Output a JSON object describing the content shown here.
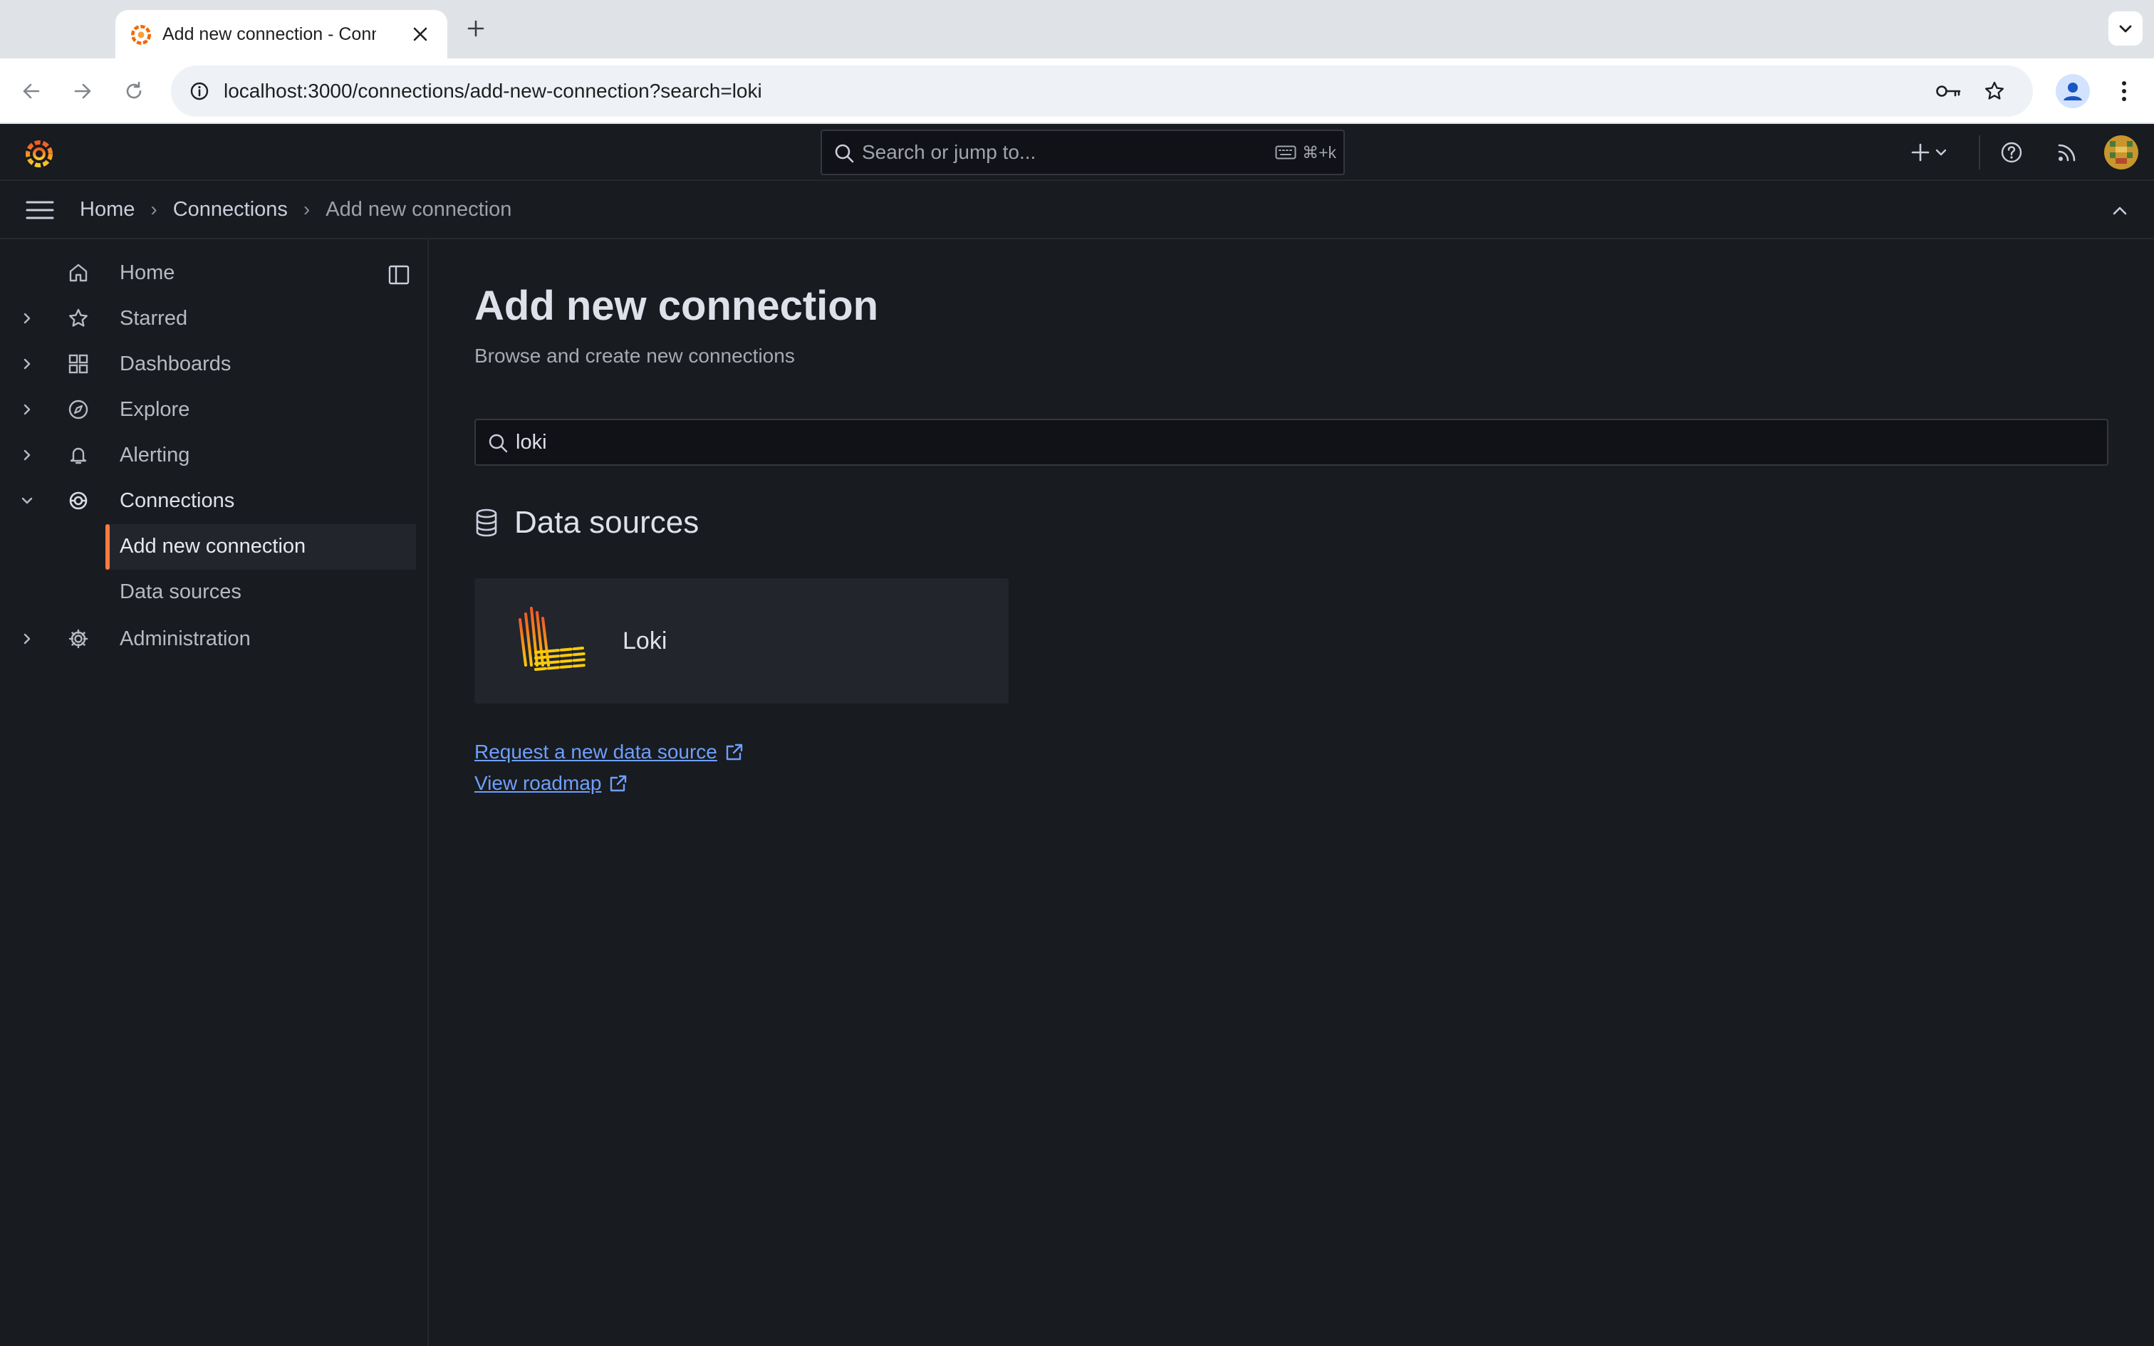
{
  "browser": {
    "tab_title": "Add new connection - Connections - Grafana",
    "url": "localhost:3000/connections/add-new-connection?search=loki"
  },
  "topbar": {
    "search_placeholder": "Search or jump to...",
    "search_shortcut": "⌘+k"
  },
  "breadcrumb": {
    "items": [
      "Home",
      "Connections"
    ],
    "current": "Add new connection",
    "separator": "›"
  },
  "sidebar": {
    "items": [
      {
        "label": "Home",
        "icon": "home-icon"
      },
      {
        "label": "Starred",
        "icon": "star-icon"
      },
      {
        "label": "Dashboards",
        "icon": "apps-icon"
      },
      {
        "label": "Explore",
        "icon": "compass-icon"
      },
      {
        "label": "Alerting",
        "icon": "bell-icon"
      },
      {
        "label": "Connections",
        "icon": "link-icon"
      },
      {
        "label": "Administration",
        "icon": "cog-icon"
      }
    ],
    "subitems": [
      {
        "label": "Add new connection",
        "active": true
      },
      {
        "label": "Data sources",
        "active": false
      }
    ]
  },
  "main": {
    "title": "Add new connection",
    "subtitle": "Browse and create new connections",
    "search_value": "loki",
    "section_title": "Data sources",
    "card_name": "Loki",
    "links": [
      "Request a new data source",
      "View roadmap"
    ]
  },
  "colors": {
    "accent": "#ff7941",
    "link": "#6e9fff",
    "background": "#181b1f",
    "card": "#22252b"
  }
}
